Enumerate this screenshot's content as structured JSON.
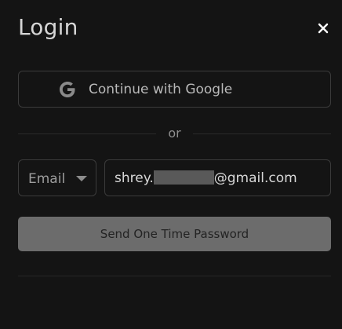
{
  "dialog": {
    "title": "Login",
    "close_icon": "close-icon"
  },
  "google_button": {
    "label": "Continue with Google",
    "icon": "google-icon"
  },
  "divider": {
    "text": "or"
  },
  "contact_type": {
    "selected": "Email",
    "icon": "chevron-down-icon"
  },
  "email_input": {
    "prefix": "shrey.",
    "suffix": "@gmail.com"
  },
  "submit_button": {
    "label": "Send One Time Password"
  },
  "colors": {
    "background": "#141414",
    "border": "#3b3b3b",
    "button_disabled": "#6c6c6c",
    "text": "#d8d8d8"
  }
}
